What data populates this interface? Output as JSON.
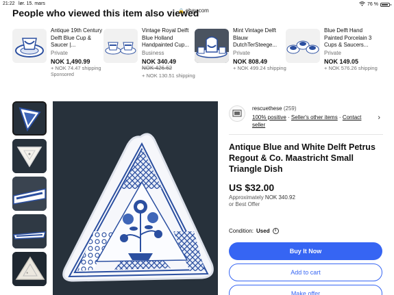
{
  "status": {
    "time": "21:22",
    "date": "lør. 15. mars",
    "url": "ebay.com",
    "battery": "76 %"
  },
  "section_title": "People who viewed this item also viewed",
  "cards": [
    {
      "title": "Antique 19th Century Delft Blue Cup & Saucer |...",
      "seller": "Private",
      "price": "NOK 1,490.99",
      "original": "",
      "shipping": "+ NOK 74.47 shipping",
      "sponsored": "Sponsored"
    },
    {
      "title": "Vintage Royal Delft Blue Holland Handpainted Cup...",
      "seller": "Business",
      "price": "NOK 340.49",
      "original": "NOK 426.62",
      "shipping": "+ NOK 130.51 shipping",
      "sponsored": ""
    },
    {
      "title": "Mint Vintage Delft Blauw DutchTerSteege...",
      "seller": "Private",
      "price": "NOK 808.49",
      "original": "",
      "shipping": "+ NOK 499.24 shipping",
      "sponsored": ""
    },
    {
      "title": "Blue Delft Hand Painted Porcelain 3 Cups & Saucers...",
      "seller": "Private",
      "price": "NOK 149.05",
      "original": "",
      "shipping": "+ NOK 576.26 shipping",
      "sponsored": ""
    }
  ],
  "seller": {
    "name": "rescuethese",
    "count": "(259)",
    "positive": "100% positive",
    "sep": " · ",
    "other_items": "Seller's other items",
    "contact": "Contact seller"
  },
  "product": {
    "title": "Antique Blue and White Delft Petrus Regout & Co. Maastricht Small Triangle Dish",
    "price": "US $32.00",
    "approx_label": "Approximately",
    "approx_value": "NOK 340.92",
    "best_offer": "or Best Offer",
    "condition_label": "Condition:",
    "condition_value": "Used"
  },
  "buttons": {
    "buy": "Buy It Now",
    "cart": "Add to cart",
    "offer": "Make offer"
  },
  "colors": {
    "accent": "#3665f3",
    "delft_blue": "#2b4fa0"
  }
}
